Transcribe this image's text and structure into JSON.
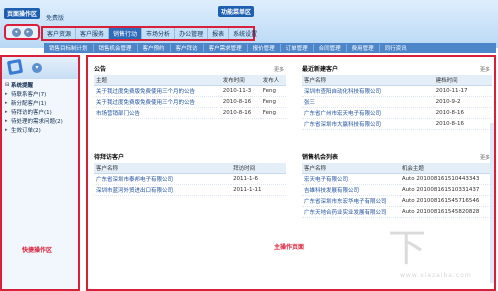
{
  "header": {
    "app_title": "免费版",
    "page_nav_label": "页面操作区",
    "menu_area_label": "功能菜单区",
    "nav_buttons": [
      "◂",
      "▸"
    ]
  },
  "menu": {
    "items": [
      "客户资源",
      "客户服务",
      "销售行动",
      "市场分析",
      "办公管理",
      "报表",
      "系统设置"
    ],
    "active_index": 2
  },
  "submenu": {
    "items": [
      "销售目标制计划",
      "销售机会管理",
      "客户预约",
      "客户拜访",
      "客户需求管理",
      "报价管理",
      "订单管理",
      "合同管理",
      "费用管理",
      "同行资讯"
    ]
  },
  "sidebar": {
    "label": "快捷操作区",
    "items": [
      {
        "label": "系统提醒",
        "root": true
      },
      {
        "label": "待联系客户(7)"
      },
      {
        "label": "新分配客户(1)"
      },
      {
        "label": "待拜访的客户(1)"
      },
      {
        "label": "待处理的需求问题(2)"
      },
      {
        "label": "生效订单(2)"
      }
    ]
  },
  "main": {
    "label": "主操作页面",
    "more_label": "更多",
    "announcements": {
      "title": "公告",
      "headers": [
        "主题",
        "发布时间",
        "发布人"
      ],
      "rows": [
        [
          "关于我过度免费版免费使用三个月的公告",
          "2010-11-3",
          "Feng"
        ],
        [
          "关于我过度免费版免费使用三个月的公告",
          "2010-8-16",
          "Feng"
        ],
        [
          "市场营销部门公告",
          "2010-8-16",
          "Feng"
        ]
      ]
    },
    "new_customers": {
      "title": "最近新建客户",
      "headers": [
        "客户名称",
        "建档时间"
      ],
      "rows": [
        [
          "深圳市查阳自动化科技有限公司",
          "2010-11-17"
        ],
        [
          "张三",
          "2010-9-2"
        ],
        [
          "广东省广州市宏天电子有限公司",
          "2010-8-16"
        ],
        [
          "广东省深圳市大赢科技有限公司",
          "2010-8-16"
        ]
      ]
    },
    "pending_visits": {
      "title": "待拜访客户",
      "headers": [
        "客户名称",
        "拜访时间"
      ],
      "rows": [
        [
          "广东省深圳市泰邦电子有限公司",
          "2011-1-6"
        ],
        [
          "深圳市蓝河外贸进出口有限公司",
          "2011-1-11"
        ]
      ]
    },
    "sales_opps": {
      "title": "销售机会列表",
      "headers": [
        "客户名称",
        "机会主题"
      ],
      "rows": [
        [
          "宏天电子有限公司",
          "Auto 201008161510443343"
        ],
        [
          "吉雄科技发展有限公司",
          "Auto 201008161510331437"
        ],
        [
          "广东省深圳市东宏华电子有限公司",
          "Auto 201008161545716546"
        ],
        [
          "广东天地合药业实业发展有限公司",
          "Auto 201008161545820828"
        ]
      ]
    }
  },
  "watermark": {
    "glyph": "下",
    "text": "www.xiazaiba.com"
  },
  "colors": {
    "annotation_red": "#d8203a",
    "menu_active": "#2e6bb8",
    "subbar": "#4d86c8"
  }
}
